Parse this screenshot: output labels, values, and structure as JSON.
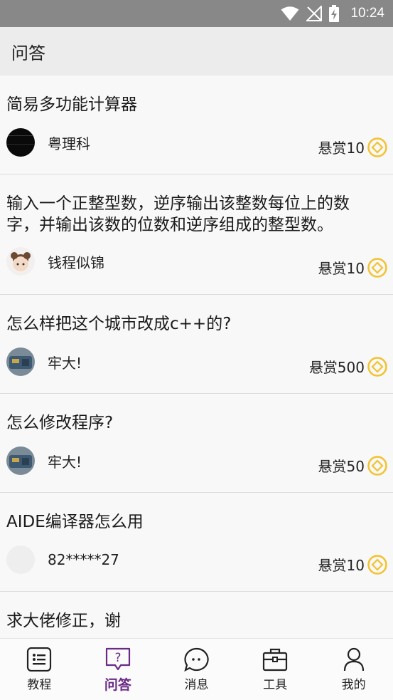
{
  "status_bar": {
    "time": "10:24"
  },
  "header": {
    "title": "问答"
  },
  "questions": [
    {
      "title": "简易多功能计算器",
      "author": "粤理科",
      "reward": "悬赏10"
    },
    {
      "title": "输入一个正整型数，逆序输出该整数每位上的数字，并输出该数的位数和逆序组成的整型数。",
      "author": "钱程似锦",
      "reward": "悬赏10"
    },
    {
      "title": "怎么样把这个城市改成c++的?",
      "author": "牢大!",
      "reward": "悬赏500"
    },
    {
      "title": "怎么修改程序?",
      "author": "牢大!",
      "reward": "悬赏50"
    },
    {
      "title": "AIDE编译器怎么用",
      "author": "82*****27",
      "reward": "悬赏10"
    },
    {
      "title": "求大佬修正，谢",
      "author": "",
      "reward": ""
    }
  ],
  "tabs": [
    {
      "label": "教程",
      "icon": "list-icon"
    },
    {
      "label": "问答",
      "icon": "question-icon"
    },
    {
      "label": "消息",
      "icon": "chat-icon"
    },
    {
      "label": "工具",
      "icon": "briefcase-icon"
    },
    {
      "label": "我的",
      "icon": "person-icon"
    }
  ],
  "colors": {
    "accent": "#6a2a86",
    "coin": "#f2c230",
    "status_bar": "#888888",
    "header_bg": "#ececec"
  }
}
